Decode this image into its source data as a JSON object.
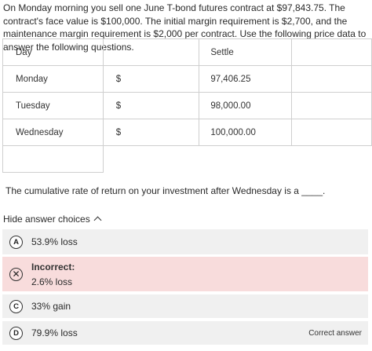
{
  "question": {
    "text": "On Monday morning you sell one June T-bond futures contract at $97,843.75. The contract's face value is $100,000. The initial margin requirement is $2,700, and the maintenance margin requirement is $2,000 per contract. Use the following price data to answer the following questions."
  },
  "table": {
    "headers": [
      "Day",
      "",
      "Settle",
      ""
    ],
    "rows": [
      {
        "day": "Monday",
        "currency": "$",
        "settle": "97,406.25"
      },
      {
        "day": "Tuesday",
        "currency": "$",
        "settle": "98,000.00"
      },
      {
        "day": "Wednesday",
        "currency": "$",
        "settle": "100,000.00"
      }
    ]
  },
  "prompt": {
    "text": "The cumulative rate of return on your investment after Wednesday is a ____."
  },
  "answers": {
    "toggle_label": "Hide answer choices",
    "choices": [
      {
        "letter": "A",
        "text": "53.9% loss"
      },
      {
        "letter": "✕",
        "status": "Incorrect:",
        "text": "2.6% loss"
      },
      {
        "letter": "C",
        "text": "33% gain"
      },
      {
        "letter": "D",
        "text": "79.9% loss",
        "tag": "Correct answer"
      }
    ]
  },
  "colors": {
    "choice_bg": "#f0f0f0",
    "incorrect_bg": "#f8dcdc",
    "border": "#cfcfcf"
  }
}
